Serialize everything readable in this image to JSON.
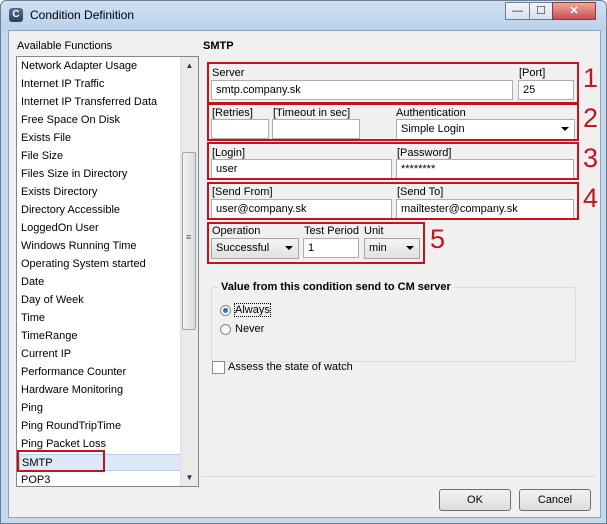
{
  "window": {
    "title": "Condition Definition",
    "icon_label": "C",
    "minimize_glyph": "—",
    "maximize_glyph": "☐",
    "close_glyph": "✕"
  },
  "functions": {
    "label": "Available Functions",
    "items": [
      "Network Adapter Usage",
      "Internet IP Traffic",
      "Internet IP Transferred Data",
      "Free Space On Disk",
      "Exists File",
      "File Size",
      "Files Size in Directory",
      "Exists Directory",
      "Directory Accessible",
      "LoggedOn User",
      "Windows Running Time",
      "Operating System started",
      "Date",
      "Day of Week",
      "Time",
      "TimeRange",
      "Current IP",
      "Performance Counter",
      "Hardware Monitoring",
      "Ping",
      "Ping RoundTripTime",
      "Ping Packet Loss",
      "SMTP",
      "POP3"
    ],
    "selected": "SMTP"
  },
  "smtp": {
    "title": "SMTP",
    "server_label": "Server",
    "server_value": "smtp.company.sk",
    "port_label": "[Port]",
    "port_value": "25",
    "retries_label": "[Retries]",
    "retries_value": "",
    "timeout_label": "[Timeout in sec]",
    "timeout_value": "",
    "auth_label": "Authentication",
    "auth_value": "Simple Login",
    "login_label": "[Login]",
    "login_value": "user",
    "password_label": "[Password]",
    "password_value": "********",
    "send_from_label": "[Send From]",
    "send_from_value": "user@company.sk",
    "send_to_label": "[Send To]",
    "send_to_value": "mailtester@company.sk",
    "operation_label": "Operation",
    "operation_value": "Successful",
    "test_period_label": "Test Period",
    "test_period_value": "1",
    "unit_label": "Unit",
    "unit_value": "min"
  },
  "annotations": [
    "1",
    "2",
    "3",
    "4",
    "5"
  ],
  "send_group": {
    "title": "Value from this condition send to CM server",
    "option_always": "Always",
    "option_never": "Never",
    "selected": "Always"
  },
  "assess_label": "Assess the state of watch",
  "buttons": {
    "ok": "OK",
    "cancel": "Cancel"
  },
  "colors": {
    "highlight": "#c0151c",
    "selection": "#dde9f7"
  }
}
